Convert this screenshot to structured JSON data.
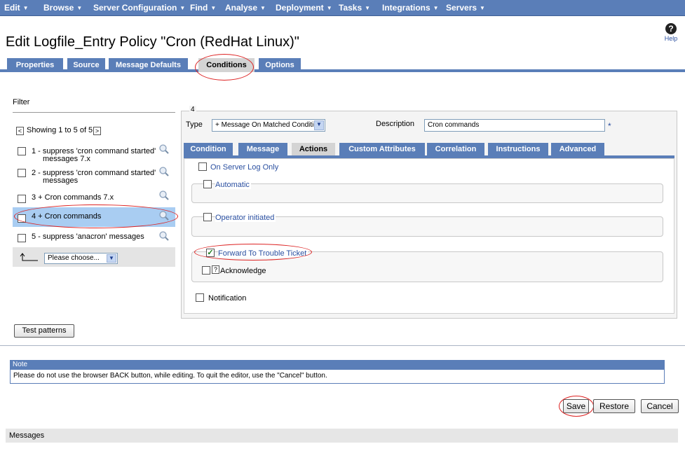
{
  "menu": [
    {
      "label": "Edit"
    },
    {
      "label": "Browse"
    },
    {
      "label": "Server Configuration"
    },
    {
      "label": "Find"
    },
    {
      "label": "Analyse"
    },
    {
      "label": "Deployment"
    },
    {
      "label": "Tasks"
    },
    {
      "label": "Integrations"
    },
    {
      "label": "Servers"
    }
  ],
  "title": "Edit Logfile_Entry Policy \"Cron (RedHat Linux)\"",
  "help_label": "Help",
  "tabs": [
    {
      "label": "Properties"
    },
    {
      "label": "Source"
    },
    {
      "label": "Message Defaults"
    },
    {
      "label": "Conditions",
      "active": true
    },
    {
      "label": "Options"
    }
  ],
  "filter": {
    "label": "Filter",
    "showing": "Showing 1 to 5 of 5",
    "prev": "<",
    "next": ">",
    "items": [
      {
        "line1": "1 -  suppress 'cron command started'",
        "line2": "messages 7.x"
      },
      {
        "line1": "2 -  suppress 'cron command started'",
        "line2": "messages"
      },
      {
        "line1": "3 + Cron commands 7.x",
        "line2": ""
      },
      {
        "line1": "4 + Cron commands",
        "line2": ""
      },
      {
        "line1": "5 -  suppress 'anacron' messages",
        "line2": ""
      }
    ],
    "action_select": "Please choose..."
  },
  "condition": {
    "number": "4",
    "type_label": "Type",
    "type_value": "+ Message On Matched Condition",
    "description_label": "Description",
    "description_value": "Cron commands",
    "required_mark": "*",
    "subtabs": [
      {
        "label": "Condition"
      },
      {
        "label": "Message"
      },
      {
        "label": "Actions",
        "active": true
      },
      {
        "label": "Custom Attributes"
      },
      {
        "label": "Correlation"
      },
      {
        "label": "Instructions"
      },
      {
        "label": "Advanced"
      }
    ],
    "actions": {
      "server_log_only": "On Server Log Only",
      "automatic": "Automatic",
      "operator_initiated": "Operator initiated",
      "forward_trouble_ticket": "Forward To Trouble Ticket",
      "acknowledge_icon": "?",
      "acknowledge": "Acknowledge",
      "notification": "Notification"
    }
  },
  "test_patterns": "Test patterns",
  "note": {
    "header": "Note",
    "text": "Please do not use the browser BACK button, while editing. To quit the editor, use the \"Cancel\" button."
  },
  "buttons": {
    "save": "Save",
    "restore": "Restore",
    "cancel": "Cancel"
  },
  "messages_label": "Messages"
}
